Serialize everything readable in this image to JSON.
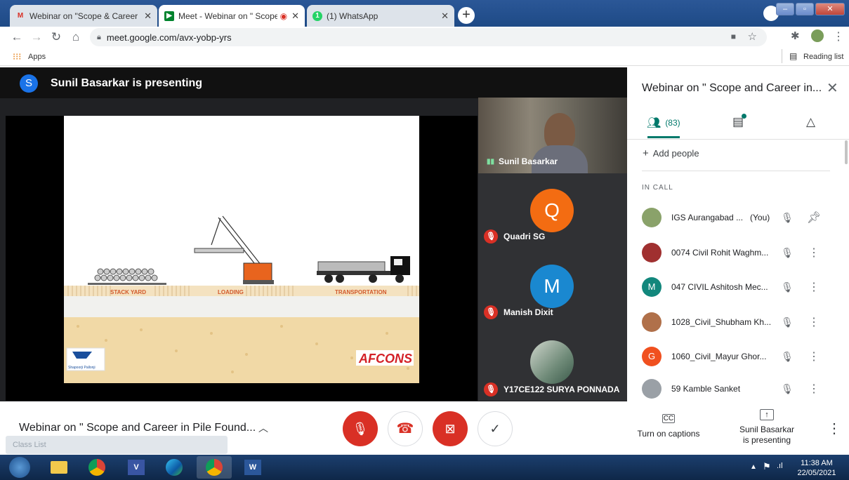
{
  "browser": {
    "tabs": [
      {
        "label": "Webinar on \"Scope & Career in F",
        "icon": "gmail-icon",
        "active": false
      },
      {
        "label": "Meet - Webinar on \" Scope a",
        "icon": "meet-icon",
        "active": true
      },
      {
        "label": "(1) WhatsApp",
        "icon": "whatsapp-icon",
        "active": false
      }
    ],
    "new_tab": "+",
    "url": "meet.google.com/avx-yobp-yrs",
    "bookmarks_apps": "Apps",
    "reading_list": "Reading list"
  },
  "meet": {
    "presenter_initial": "S",
    "presenting_text": "Sunil Basarkar is presenting",
    "slide": {
      "labels": [
        "STACK YARD",
        "LOADING",
        "TRANSPORTATION"
      ],
      "logo_left": "Shapoorji Pallonji",
      "logo_right": "AFCONS"
    },
    "tiles": [
      {
        "name": "Sunil Basarkar",
        "initial": "",
        "color": ""
      },
      {
        "name": "Quadri SG",
        "initial": "Q",
        "color": "#f36c12"
      },
      {
        "name": "Manish Dixit",
        "initial": "M",
        "color": "#1a88d0"
      },
      {
        "name": "Y17CE122 SURYA PONNADA",
        "initial": "",
        "color": ""
      }
    ]
  },
  "panel": {
    "title": "Webinar on \" Scope and Career in...",
    "people_count": "(83)",
    "add_people": "Add people",
    "section": "IN CALL",
    "participants": [
      {
        "name": "IGS Aurangabad ...",
        "you": "(You)",
        "initial": "",
        "color": "#8aa26a"
      },
      {
        "name": "0074 Civil Rohit Waghm...",
        "you": "",
        "initial": "",
        "color": "#a03030"
      },
      {
        "name": "047 CIVIL Ashitosh Mec...",
        "you": "",
        "initial": "M",
        "color": "#12877c"
      },
      {
        "name": "1028_Civil_Shubham Kh...",
        "you": "",
        "initial": "",
        "color": "#b0704a"
      },
      {
        "name": "1060_Civil_Mayur Ghor...",
        "you": "",
        "initial": "G",
        "color": "#f0501f"
      },
      {
        "name": "59 Kamble Sanket",
        "you": "",
        "initial": "",
        "color": "#9aa0a6"
      }
    ]
  },
  "controls": {
    "meeting_title": "Webinar on \" Scope and Career in Pile Found...",
    "class_list": "Class List",
    "captions": "Turn on captions",
    "presenting_line1": "Sunil Basarkar",
    "presenting_line2": "is presenting"
  },
  "taskbar": {
    "time": "11:38 AM",
    "date": "22/05/2021"
  }
}
